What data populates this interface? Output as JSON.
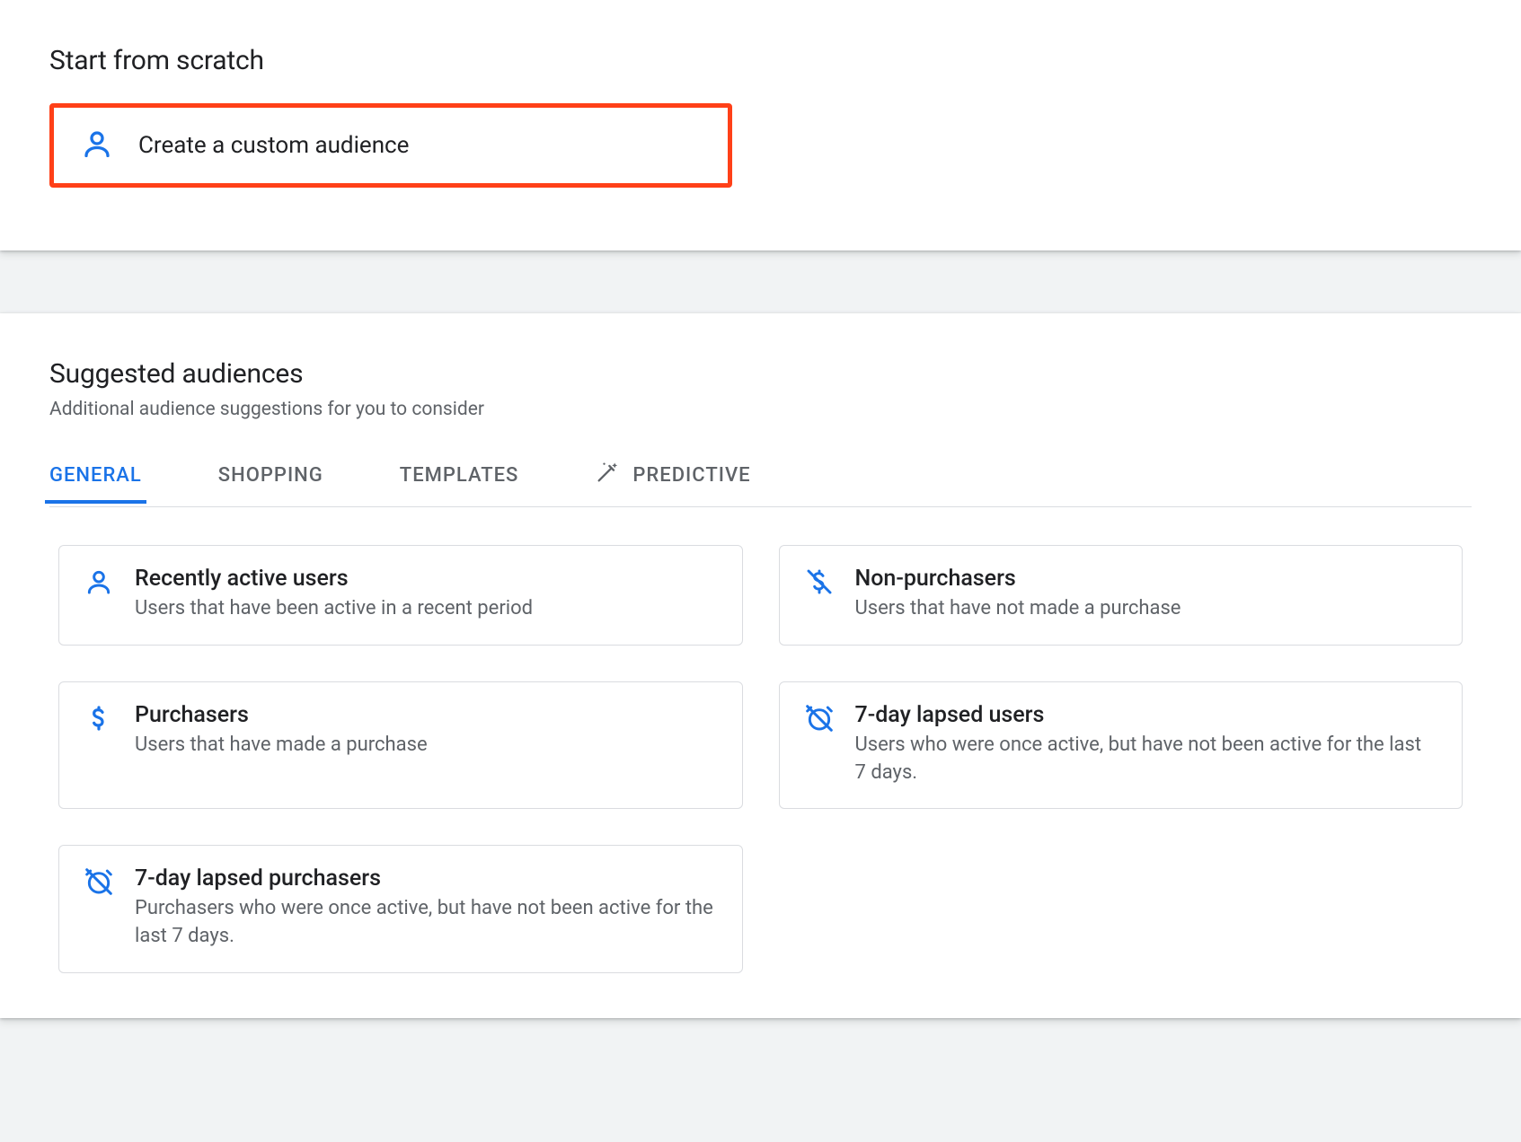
{
  "scratch": {
    "title": "Start from scratch",
    "create_label": "Create a custom audience"
  },
  "suggested": {
    "title": "Suggested audiences",
    "subtitle": "Additional audience suggestions for you to consider",
    "tabs": {
      "general": "GENERAL",
      "shopping": "SHOPPING",
      "templates": "TEMPLATES",
      "predictive": "PREDICTIVE"
    },
    "cards": {
      "recently_active": {
        "title": "Recently active users",
        "desc": "Users that have been active in a recent period"
      },
      "non_purchasers": {
        "title": "Non-purchasers",
        "desc": "Users that have not made a purchase"
      },
      "purchasers": {
        "title": "Purchasers",
        "desc": "Users that have made a purchase"
      },
      "lapsed_users": {
        "title": "7-day lapsed users",
        "desc": "Users who were once active, but have not been active for the last 7 days."
      },
      "lapsed_purchasers": {
        "title": "7-day lapsed purchasers",
        "desc": "Purchasers who were once active, but have not been active for the last 7 days."
      }
    }
  },
  "colors": {
    "accent": "#1a73e8",
    "highlight_border": "#ff4018"
  }
}
